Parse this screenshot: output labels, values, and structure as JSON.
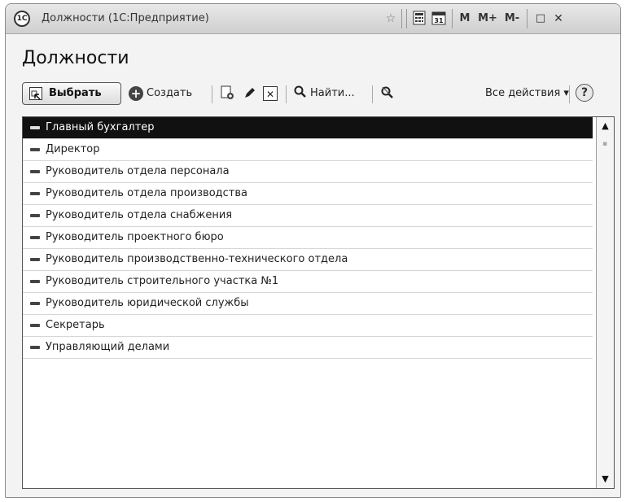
{
  "window": {
    "title": "Должности (1С:Предприятие)",
    "icon_label": "1С",
    "controls": {
      "favorite_icon": "star-icon",
      "calculator_icon": "calculator-icon",
      "calendar_icon": "calendar-icon",
      "calendar_day": "31",
      "m_label": "M",
      "m_plus_label": "M+",
      "m_minus_label": "M-",
      "maximize_glyph": "□",
      "close_glyph": "✕"
    }
  },
  "page": {
    "title": "Должности"
  },
  "toolbar": {
    "select_label": "Выбрать",
    "create_label": "Создать",
    "copy_icon": "copy-icon",
    "edit_icon": "pencil-icon",
    "delete_icon": "delete-icon",
    "find_label": "Найти...",
    "cancel_search_icon": "cancel-search-icon",
    "all_actions_label": "Все действия ▾",
    "help_label": "?"
  },
  "list": {
    "items": [
      {
        "label": "Главный бухгалтер",
        "selected": true
      },
      {
        "label": "Директор"
      },
      {
        "label": "Руководитель отдела персонала"
      },
      {
        "label": "Руководитель отдела производства"
      },
      {
        "label": "Руководитель отдела снабжения"
      },
      {
        "label": "Руководитель проектного бюро"
      },
      {
        "label": "Руководитель производственно-технического отдела"
      },
      {
        "label": "Руководитель строительного участка №1"
      },
      {
        "label": "Руководитель юридической службы"
      },
      {
        "label": "Секретарь"
      },
      {
        "label": "Управляющий делами"
      }
    ]
  },
  "scrollbar": {
    "up_glyph": "▲",
    "down_glyph": "▼"
  }
}
